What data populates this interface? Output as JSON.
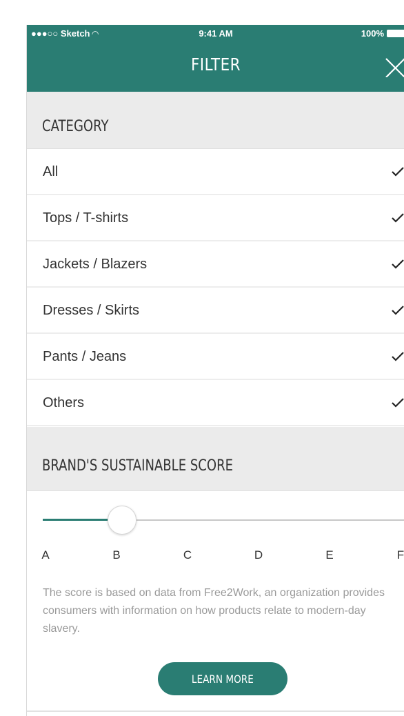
{
  "status_bar": {
    "carrier": "●●●○○ Sketch",
    "time": "9:41 AM",
    "battery": "100%"
  },
  "header": {
    "title": "FILTER",
    "close_icon": "close-icon"
  },
  "category": {
    "heading": "CATEGORY",
    "items": [
      {
        "label": "All",
        "checked": true
      },
      {
        "label": "Tops / T-shirts",
        "checked": true
      },
      {
        "label": "Jackets / Blazers",
        "checked": true
      },
      {
        "label": "Dresses / Skirts",
        "checked": true
      },
      {
        "label": "Pants / Jeans",
        "checked": true
      },
      {
        "label": "Others",
        "checked": true
      }
    ]
  },
  "score": {
    "heading": "BRAND'S SUSTAINABLE SCORE",
    "grades": [
      "A",
      "B",
      "C",
      "D",
      "E",
      "F"
    ],
    "selected_grade": "B",
    "description": "The score is based on data from Free2Work, an organization provides consumers with information on how products relate to modern-day slavery.",
    "button_label": "LEARN MORE"
  },
  "colors": {
    "accent": "#2a7d73",
    "section_bg": "#ebebeb",
    "muted_text": "#9a9a9a"
  }
}
